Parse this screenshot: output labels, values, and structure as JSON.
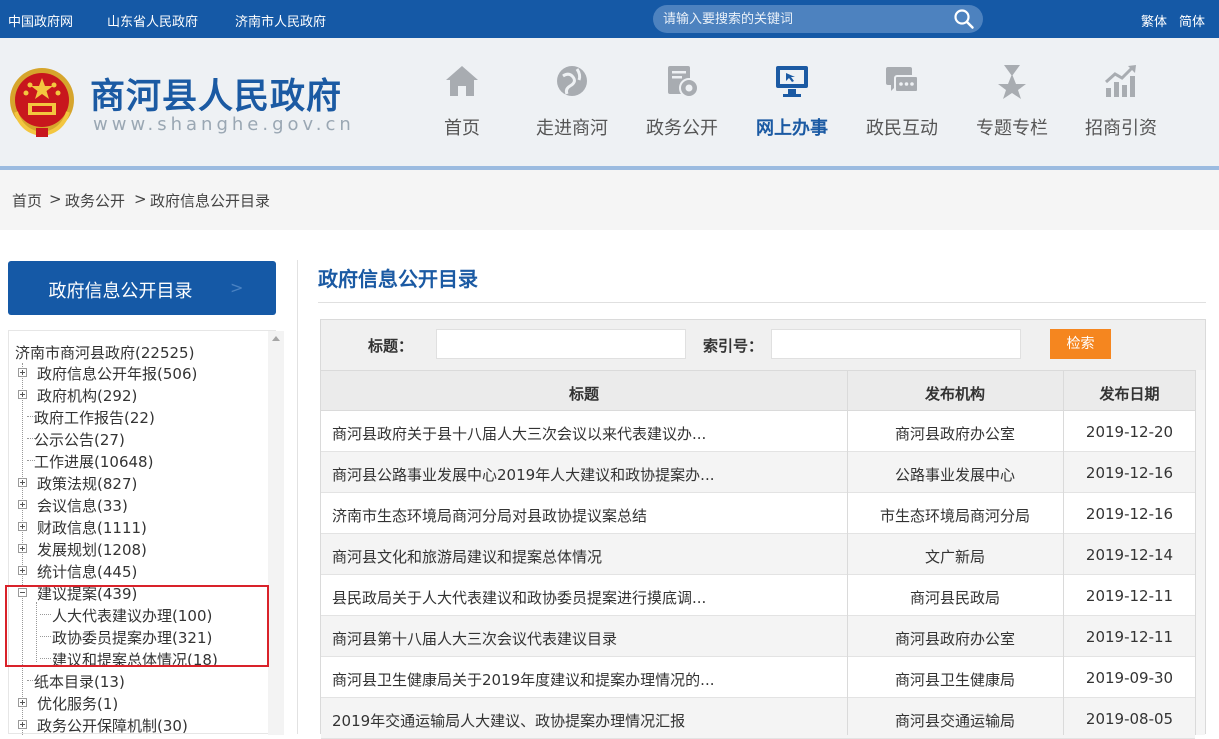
{
  "topbar": {
    "links": [
      "中国政府网",
      "山东省人民政府",
      "济南市人民政府"
    ],
    "search_placeholder": "请输入要搜索的关键词",
    "lang_traditional": "繁体",
    "lang_simplified": "简体"
  },
  "header": {
    "site_title": "商河县人民政府",
    "site_url": "www.shanghe.gov.cn",
    "nav": [
      {
        "label": "首页",
        "icon": "home-icon"
      },
      {
        "label": "走进商河",
        "icon": "globe-icon"
      },
      {
        "label": "政务公开",
        "icon": "gear-doc-icon"
      },
      {
        "label": "网上办事",
        "icon": "monitor-icon",
        "active": true
      },
      {
        "label": "政民互动",
        "icon": "chat-icon"
      },
      {
        "label": "专题专栏",
        "icon": "star-badge-icon"
      },
      {
        "label": "招商引资",
        "icon": "growth-chart-icon"
      }
    ]
  },
  "breadcrumb": [
    "首页",
    "政务公开",
    "政府信息公开目录"
  ],
  "sidebar": {
    "title": "政府信息公开目录",
    "arrow": ">",
    "tree": {
      "root": "济南市商河县政府(22525)",
      "n1": "政府信息公开年报(506)",
      "n2": "政府机构(292)",
      "n3": "政府工作报告(22)",
      "n4": "公示公告(27)",
      "n5": "工作进展(10648)",
      "n6": "政策法规(827)",
      "n7": "会议信息(33)",
      "n8": "财政信息(1111)",
      "n9": "发展规划(1208)",
      "n10": "统计信息(445)",
      "n11": "建议提案(439)",
      "c1": "人大代表建议办理(100)",
      "c2": "政协委员提案办理(321)",
      "c3": "建议和提案总体情况(18)",
      "n12": "纸本目录(13)",
      "n13": "优化服务(1)",
      "n14": "政务公开保障机制(30)"
    }
  },
  "main": {
    "title": "政府信息公开目录",
    "filter": {
      "title_label": "标题：",
      "index_label": "索引号：",
      "search_button": "检索"
    },
    "columns": [
      "标题",
      "发布机构",
      "发布日期"
    ],
    "rows": [
      {
        "title": "商河县政府关于县十八届人大三次会议以来代表建议办...",
        "org": "商河县政府办公室",
        "date": "2019-12-20"
      },
      {
        "title": "商河县公路事业发展中心2019年人大建议和政协提案办...",
        "org": "公路事业发展中心",
        "date": "2019-12-16"
      },
      {
        "title": "济南市生态环境局商河分局对县政协提议案总结",
        "org": "市生态环境局商河分局",
        "date": "2019-12-16"
      },
      {
        "title": "商河县文化和旅游局建议和提案总体情况",
        "org": "文广新局",
        "date": "2019-12-14"
      },
      {
        "title": "县民政局关于人大代表建议和政协委员提案进行摸底调...",
        "org": "商河县民政局",
        "date": "2019-12-11"
      },
      {
        "title": "商河县第十八届人大三次会议代表建议目录",
        "org": "商河县政府办公室",
        "date": "2019-12-11"
      },
      {
        "title": "商河县卫生健康局关于2019年度建议和提案办理情况的...",
        "org": "商河县卫生健康局",
        "date": "2019-09-30"
      },
      {
        "title": "2019年交通运输局人大建议、政协提案办理情况汇报",
        "org": "商河县交通运输局",
        "date": "2019-08-05"
      }
    ]
  },
  "colors": {
    "brand_blue": "#1559a6",
    "accent_orange": "#f5861f",
    "highlight_red": "#d9222a"
  }
}
